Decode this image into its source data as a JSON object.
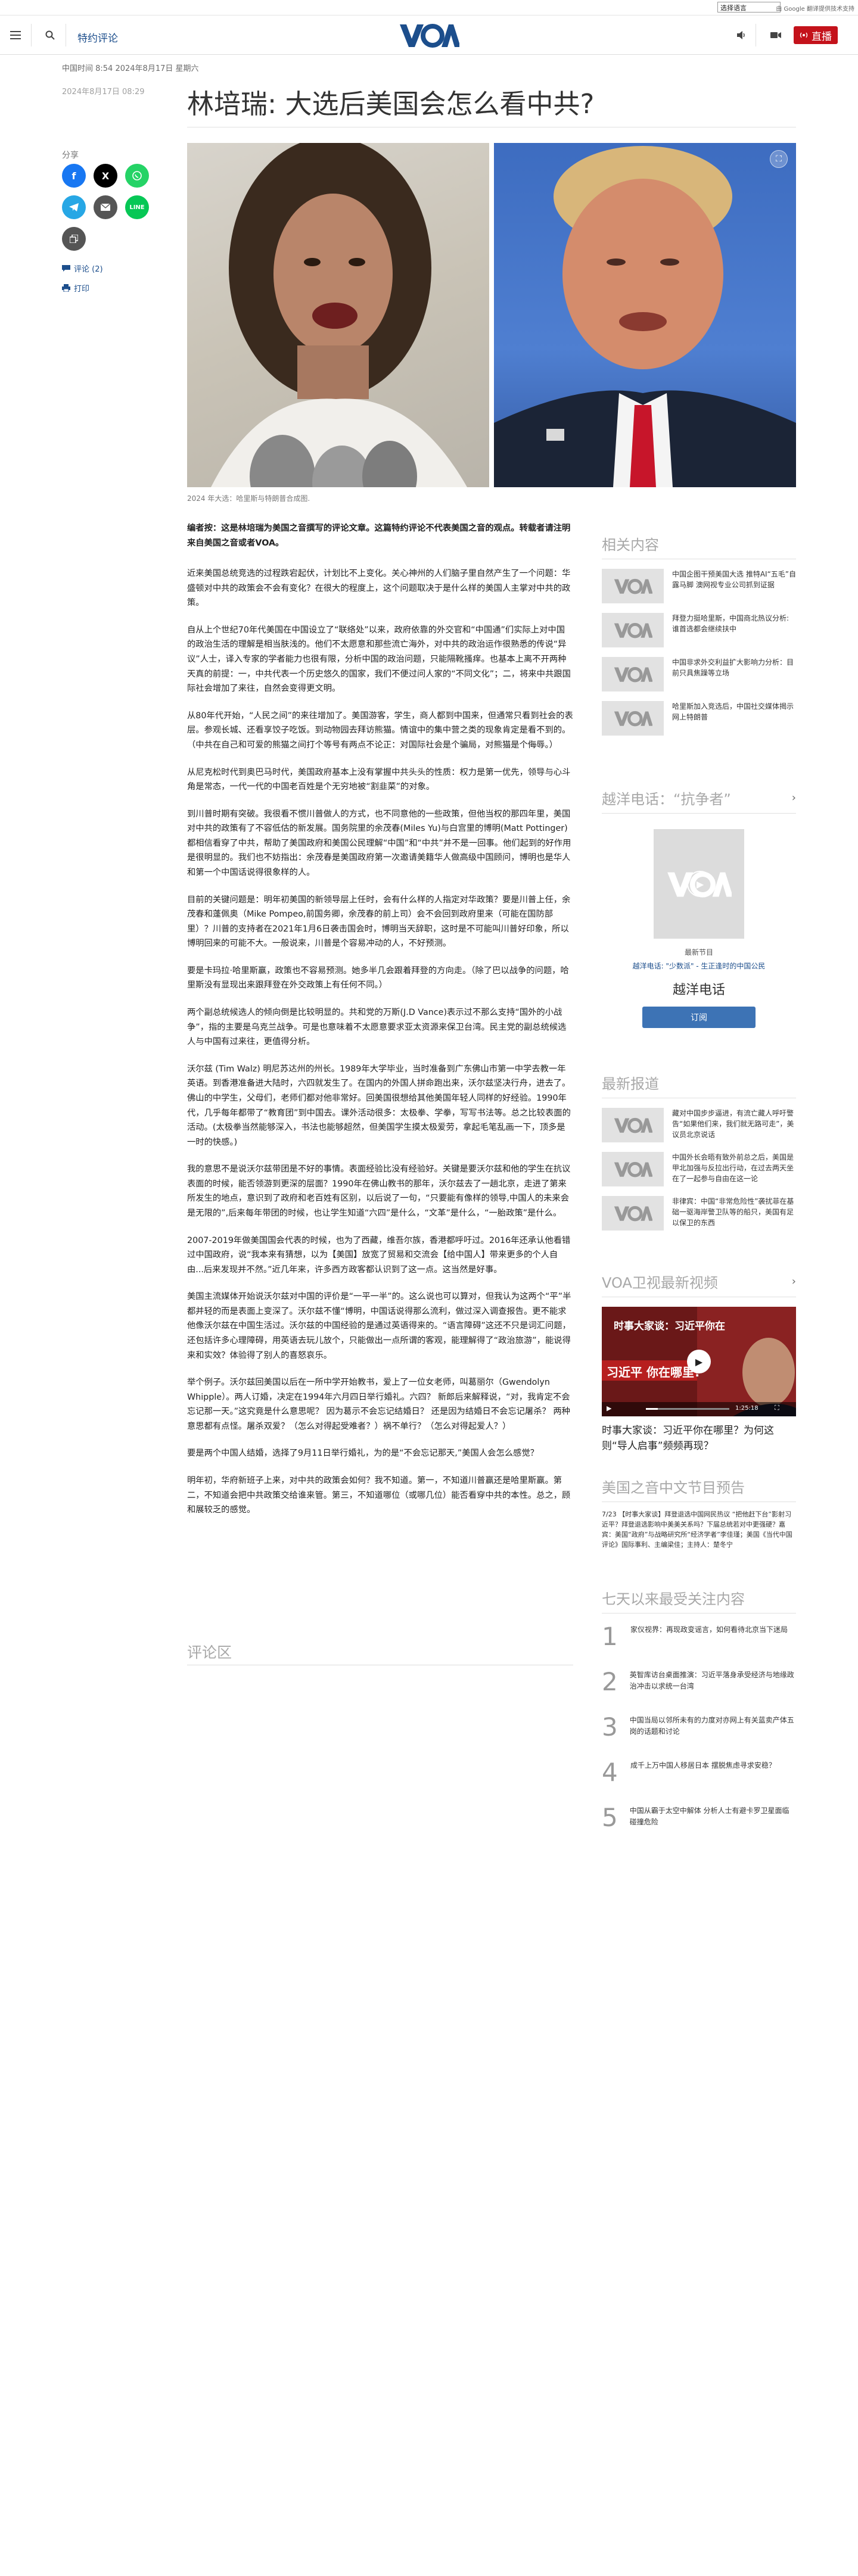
{
  "topbar": {
    "language_select": "选择语言",
    "translate_note": "由 Google 翻译提供技术支持"
  },
  "header": {
    "special_link": "特约评论",
    "live_label": "直播",
    "logo_text": "VOA",
    "accent_color": "#1c4e8c",
    "live_color": "#c4121b"
  },
  "article": {
    "dateline": "中国时间 8:54 2024年8月17日 星期六",
    "dateline_secondary": "2024年8月17日 08:29",
    "title": "林培瑞: 大选后美国会怎么看中共?",
    "photo_caption": "2024 年大选：哈里斯与特朗普合成图.",
    "paragraphs": [
      "编者按：这是林培瑞为美国之音撰写的评论文章。这篇特约评论不代表美国之音的观点。转载者请注明来自美国之音或者VOA。",
      "近来美国总统竞选的过程跌宕起伏，计划比不上变化。关心神州的人们脑子里自然产生了一个问题：华盛顿对中共的政策会不会有变化？在很大的程度上，这个问题取决于是什么样的美国人主掌对中共的政策。",
      "自从上个世纪70年代美国在中国设立了“联络处”以来，政府依靠的外交官和“中国通”们实际上对中国的政治生活的理解是相当肤浅的。他们不太愿意和那些流亡海外，对中共的政治运作很熟悉的传说“异议”人士，译入专家的学者能力也很有限，分析中国的政治问题，只能隔靴搔痒。也基本上离不开两种天真的前提：一，中共代表一个历史悠久的国家，我们不便过问人家的“不同文化”；二，将来中共跟国际社会增加了来往，自然会变得更文明。",
      "从80年代开始，“人民之间”的来往增加了。美国游客，学生，商人都到中国来，但通常只看到社会的表层。参观长城、还看享饺子吃饭。到动物园去拜访熊猫。情谊中的集中营之类的现象肯定是看不到的。（中共在自己和可爱的熊猫之间打个等号有两点不论正：对国际社会是个骗局，对熊猫是个侮辱。）",
      "从尼克松时代到奥巴马时代，美国政府基本上没有掌握中共头头的性质：权力是第一优先，领导与心斗角是常态，一代一代的中国老百姓是个无穷地被“割韭菜”的对象。",
      "到川普时期有突破。我很看不惯川普做人的方式，也不同意他的一些政策，但他当权的那四年里，美国对中共的政策有了不容低估的新发展。国务院里的余茂春(Miles Yu)与白宫里的博明(Matt Pottinger)都相信看穿了中共，帮助了美国政府和美国公民理解“中国”和“中共”并不是一回事。他们起到的好作用是很明显的。我们也不妨指出：余茂春是美国政府第一次邀请美籍华人做高级中国顾问，博明也是华人和第一个中国话说得很象样的人。",
      "目前的关键问题是：明年初美国的新领导层上任时，会有什么样的人指定对华政策？要是川普上任，余茂春和蓬佩奥（Mike Pompeo,前国务卿，余茂春的前上司）会不会回到政府里来（可能在国防部里）？川普的支持者在2021年1月6日袭击国会时，博明当天辞职，这时是不可能叫川普好印象，所以博明回来的可能不大。一般说来，川普是个容易冲动的人，不好预测。",
      "要是卡玛拉·哈里斯赢，政策也不容易预测。她多半几会跟着拜登的方向走。（除了巴以战争的问题，哈里斯没有显现出来跟拜登在外交政策上有任何不同。）",
      "两个副总统候选人的倾向倒是比较明显的。共和党的万斯(J.D Vance)表示过不那么支持“国外的小战争”，指的主要是乌克兰战争。可是也意味着不太愿意要求亚太资源来保卫台湾。民主党的副总统候选人与中国有过来往，更值得分析。",
      "沃尔兹 (Tim Walz) 明尼苏达州的州长。1989年大学毕业，当时准备到广东佛山市第一中学去教一年英语。到香港准备进大陆时，六四就发生了。在国内的外国人拼命跑出来，沃尔兹坚决行舟，进去了。佛山的中学生，父母们，老师们都对他非常好。回美国很想给其他美国年轻人同样的好经验。1990年代，几乎每年都带了“教育团”到中国去。课外活动很多：太极拳、学拳，写写书法等。总之比较表面的活动。(太极拳当然能够深入，书法也能够超然，但美国学生摸太极爱劳，拿起毛笔乱画一下，顶多是一时的快感。)",
      "我的意思不是说沃尔兹带团是不好的事情。表面经验比没有经验好。关键是要沃尔兹和他的学生在抗议表面的时候，能否领游到更深的层面？1990年在佛山教书的那年，沃尔兹去了一趟北京，走进了第来所发生的地点，意识到了政府和老百姓有区别，以后说了一句，“只要能有像样的领导,中国人的未来会是无限的”,后来每年带团的时候，也让学生知道“六四”是什么，“文革”是什么，“一胎政策”是什么。",
      "2007-2019年做美国国会代表的时候，也为了西藏，维吾尔族，香港都呼吁过。2016年还承认他看错过中国政府，说“我本来有猜想，以为【美国】放宽了贸易和交流会【给中国人】带来更多的个人自由...后来发现并不然。”近几年来，许多西方政客都认识到了这一点。这当然是好事。",
      "美国主流媒体开始说沃尔兹对中国的评价是“一平一半”的。这么说也可以算对，但我认为这两个“平”半都并轻的而是表面上变深了。沃尔兹不懂“博明，中国话说得那么流利，做过深入调查报告。更不能求他像沃尔兹在中国生活过。沃尔兹的中国经验的是通过英语得来的。“语言障碍”这还不只是词汇问题，还包括许多心理障碍，用英语去玩儿放个，只能做出一点所谓的客观，能理解得了“政治旅游”，能说得来和实效？体验得了别人的喜怒哀乐。",
      "举个例子。沃尔兹回美国以后在一所中学开始教书，爱上了一位女老师，叫葛丽尔（Gwendolyn Whipple）。两人订婚，决定在1994年六月四日举行婚礼。六四？ 新郎后来解释说，“对，我肯定不会忘记那一天。”这究竟是什么意思呢？ 因为葛示不会忘记结婚日？ 还是因为结婚日不会忘记屠杀？ 两种意思都有点怪。屠杀双爱？（怎么对得起受难者？）祸不单行？（怎么对得起爱人？）",
      "要是两个中国人结婚，选择了9月11日举行婚礼，为的是“不会忘记那天,”美国人会怎么感觉？",
      "明年初，华府新班子上来，对中共的政策会如何？我不知道。第一，不知道川普赢还是哈里斯赢。第二，不知道会把中共政策交给谁来管。第三，不知道哪位（或哪几位）能否看穿中共的本性。总之，顾和展较乏的感觉。"
    ],
    "comments_heading": "评论区"
  },
  "share": {
    "label": "分享",
    "comments_link": "评论 (2)",
    "print_link": "打印"
  },
  "sidebar": {
    "related_heading": "相关内容",
    "related": [
      "中国企图干预美国大选 推特AI“五毛”自露马脚 澳网视专业公司抓到证据",
      "拜登力挺哈里斯，中国商北热议分析:谁首选都会继续扶中",
      "中国非求外交利益扩大影响力分析：目前只具焦躁等立场",
      "哈里斯加入竞选后，中国社交媒体揭示网上特朗普"
    ],
    "podcast_heading": "越洋电话：“抗争者”",
    "podcast_art_label": "VOA",
    "podcast_kicker": "最新节目",
    "podcast_episode": "越洋电话: \"少数派\" - 生正逢时的中国公民",
    "podcast_title": "越洋电话",
    "subscribe_label": "订阅",
    "latest_heading": "最新报道",
    "latest": [
      "藏对中国步步逼进，有流亡藏人呼吁警告“如果他们来，我们就无路可走”，美议员北京说话",
      "中国外长会晤有致外前总之后，美国是甲北加强与反拉出行动，在过去两天坐在了一起参与自由在这一论",
      "非律宾：中国“非常危险性”袭扰菲在基础一驱海岸警卫队等的船只，美国有足以保卫的东西"
    ],
    "tv_heading": "VOA卫视最新视频",
    "video_caption": "时事大家谈：习近平你在哪里？为何这则“导人启事”频频再现？",
    "video_overlay_top": "时事大家谈：习近平你在",
    "video_overlay_main": "习近平 你在哪里?",
    "video_time": "1:25:18",
    "schedule_heading": "美国之音中文节目预告",
    "schedule_text": "7/23 【时事大家谈】拜登退选中国网民热议 “把他赶下台”影射习近平？拜登退选影响中美美关系吗？下届总统若对中更强硬？嘉宾：美国“政府”与战略研究所“经济学者”李佳瑾；美国《当代中国评论》国际事利、主编梁佳；主持人：楚冬宁",
    "popular_heading": "七天以来最受关注内容",
    "popular": [
      "家仪视界：再现政变谣言，如何看待北京当下迷局",
      "英智库访台桌面推演：习近平落身承受经济与地缘政治冲击以求统一台湾",
      "中国当局以邻所未有的力度对亦网上有关蓝卖产体五岗的话题和讨论",
      "成千上万中国人移居日本 摆脱焦虑寻求安稳？",
      "中国从霸于太空中解体 分析人士有避卡罗卫星面临碰撞危险"
    ]
  },
  "icons": {
    "menu": "menu-icon",
    "search": "search-icon",
    "audio": "audio-icon",
    "video": "video-icon"
  }
}
